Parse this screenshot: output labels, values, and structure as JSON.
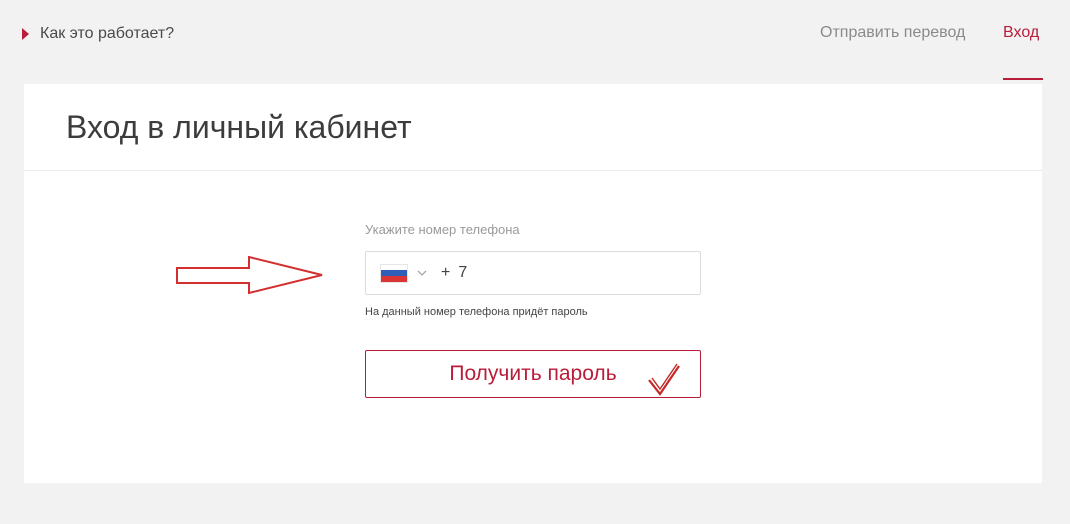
{
  "topbar": {
    "how_it_works": "Как это работает?",
    "nav": {
      "send_transfer": "Отправить перевод",
      "login": "Вход"
    }
  },
  "card": {
    "title": "Вход в личный кабинет",
    "phone": {
      "label": "Укажите номер телефона",
      "country_flag": "russia-flag-icon",
      "prefix": "+",
      "value": "7",
      "hint": "На данный номер телефона придёт пароль"
    },
    "submit_label": "Получить пароль"
  },
  "annotations": {
    "arrow": "red-outline-arrow-icon",
    "checkmark": "red-check-icon"
  },
  "colors": {
    "accent": "#b81d3a",
    "background": "#f2f2f2",
    "card": "#ffffff",
    "muted_text": "#9a9a9a"
  }
}
